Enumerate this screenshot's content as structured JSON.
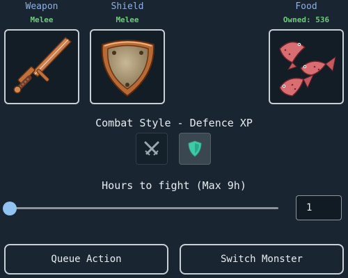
{
  "equipment": {
    "weapon": {
      "title": "Weapon",
      "subtitle": "Melee",
      "icon": "bronze-sword-icon"
    },
    "shield": {
      "title": "Shield",
      "subtitle": "Melee",
      "icon": "bronze-shield-icon"
    },
    "food": {
      "title": "Food",
      "subtitle": "Owned: 536",
      "icon": "fish-icon"
    }
  },
  "combat_style": {
    "heading": "Combat Style - Defence XP",
    "options": [
      {
        "icon": "crossed-swords-icon",
        "selected": false
      },
      {
        "icon": "shield-icon",
        "selected": true
      }
    ]
  },
  "hours": {
    "heading": "Hours to fight (Max 9h)",
    "value": "1",
    "slider_fraction": 0.0
  },
  "actions": {
    "queue_label": "Queue Action",
    "switch_label": "Switch Monster"
  },
  "colors": {
    "background": "#192631",
    "slot_title": "#8fb0e6",
    "slot_subtitle": "#6fca7e",
    "slider_thumb": "#90c3f0",
    "selected_style_icon": "#3ec9a7"
  }
}
